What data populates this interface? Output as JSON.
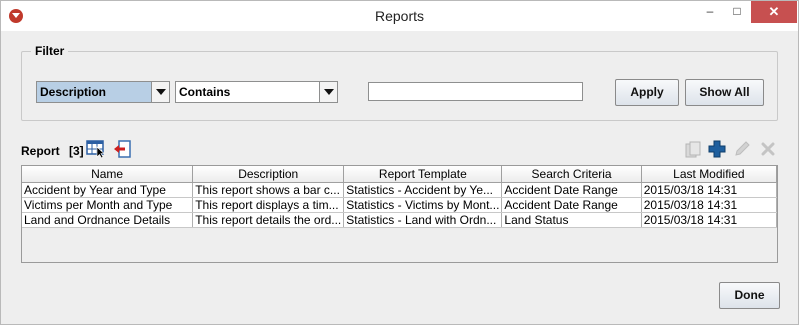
{
  "window": {
    "title": "Reports",
    "minimize_label": "–",
    "maximize_label": "□",
    "close_label": "✕"
  },
  "filter": {
    "legend": "Filter",
    "field_selected": "Description",
    "operator_selected": "Contains",
    "search_value": "",
    "apply_label": "Apply",
    "show_all_label": "Show All"
  },
  "report": {
    "label": "Report",
    "count": "[3]",
    "icons": [
      "table-select-icon",
      "export-icon",
      "copy-icon",
      "add-icon",
      "edit-icon",
      "delete-icon"
    ]
  },
  "table": {
    "columns": [
      "Name",
      "Description",
      "Report Template",
      "Search Criteria",
      "Last Modified"
    ],
    "rows": [
      [
        "Accident by Year and Type",
        "This report shows a bar c...",
        "Statistics - Accident by Ye...",
        "Accident Date Range",
        "2015/03/18 14:31"
      ],
      [
        "Victims per Month and Type",
        "This report displays a tim...",
        "Statistics - Victims by Mont...",
        "Accident Date Range",
        "2015/03/18 14:31"
      ],
      [
        "Land and Ordnance Details",
        "This report details the ord...",
        "Statistics - Land with Ordn...",
        "Land Status",
        "2015/03/18 14:31"
      ]
    ]
  },
  "footer": {
    "done_label": "Done"
  },
  "colors": {
    "selected_combo": "#b8cfe5",
    "close_button": "#c75050",
    "add_icon": "#1f5f9e",
    "export_arrow": "#cc1f1f"
  }
}
